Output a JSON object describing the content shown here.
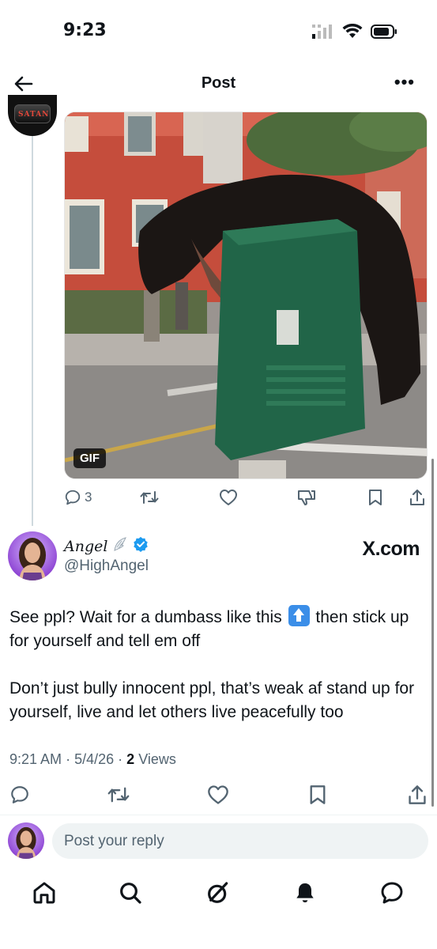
{
  "status": {
    "time": "9:23"
  },
  "nav": {
    "title": "Post",
    "more": "•••"
  },
  "parent": {
    "avatar_text": "SATAN",
    "media_badge": "GIF",
    "reply_count": "3"
  },
  "tweet": {
    "author_name": "Angel",
    "handle": "@HighAngel",
    "watermark": "X.com",
    "para1_a": "See ppl? Wait for a dumbass like this",
    "para1_b": "then stick up for yourself and tell em off",
    "para2": "Don’t just bully innocent ppl, that’s weak af stand up for yourself, live and let others live peacefully too",
    "time": "9:21 AM",
    "date": "5/4/26",
    "views_count": "2",
    "views_label": "Views",
    "sep": "·"
  },
  "reply": {
    "placeholder": "Post your reply"
  },
  "colors": {
    "accent": "#1d9bf0",
    "muted": "#536471"
  },
  "tabs": [
    "home-icon",
    "search-icon",
    "grok-icon",
    "notifications-icon",
    "messages-icon"
  ]
}
